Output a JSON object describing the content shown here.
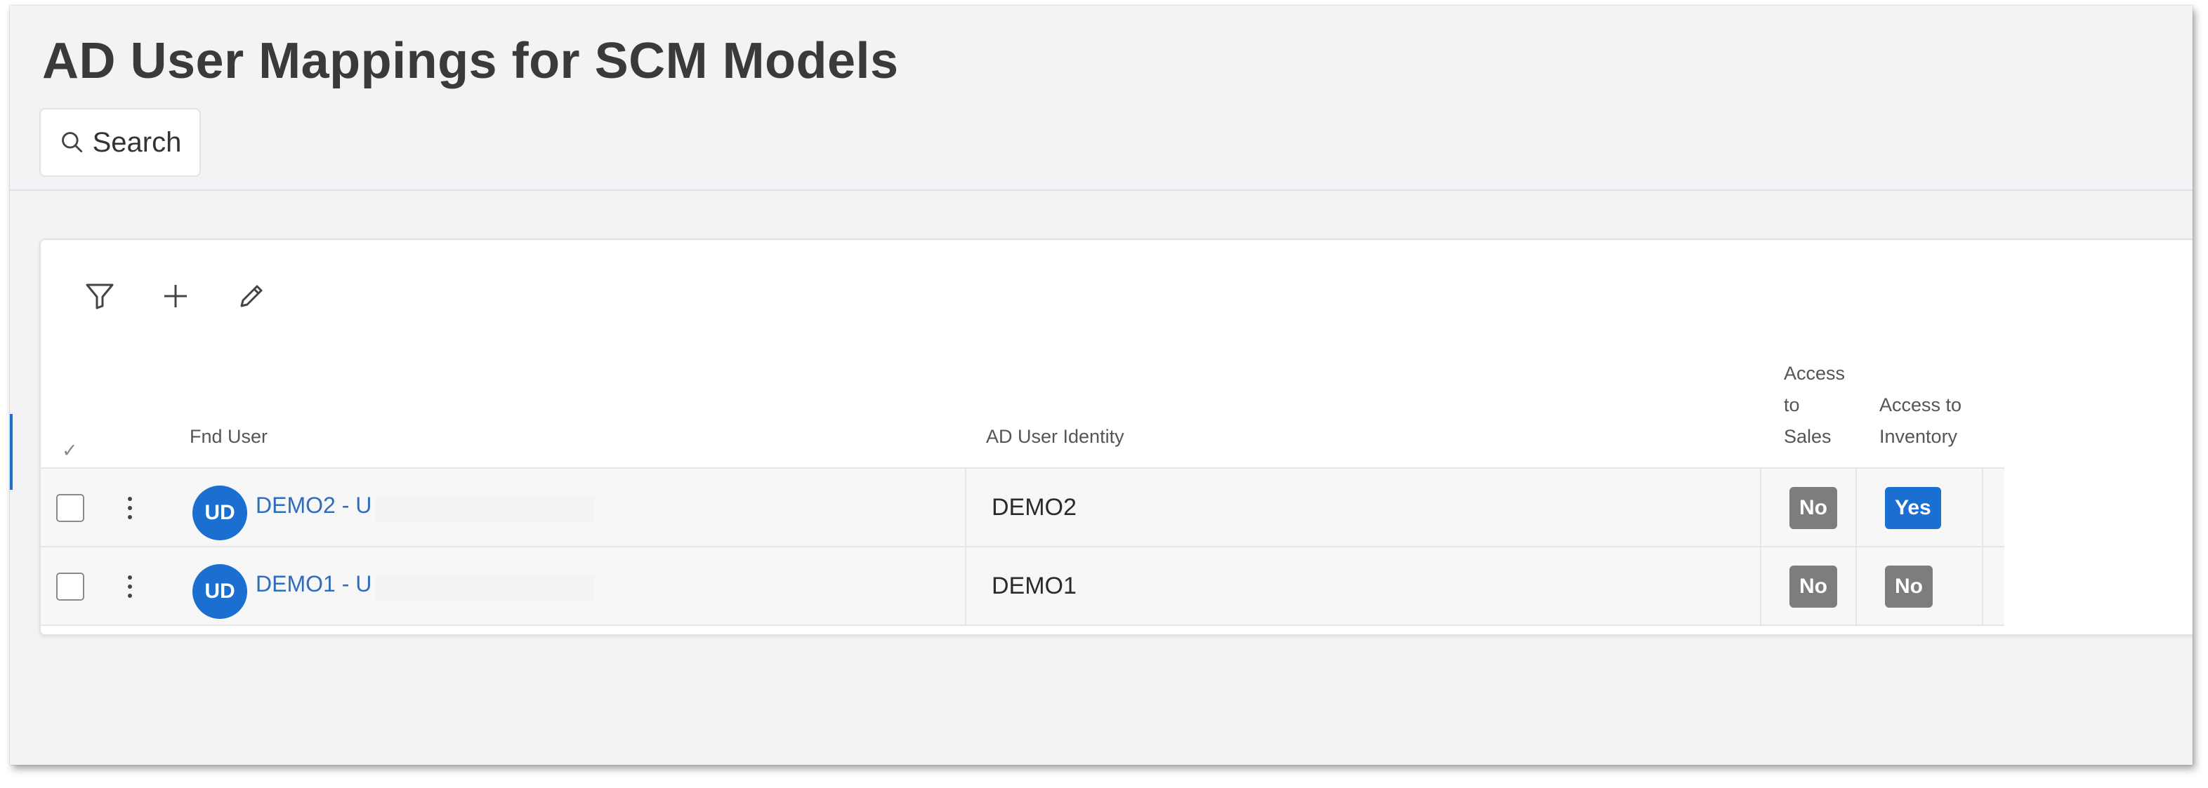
{
  "page": {
    "title": "AD User Mappings for SCM Models"
  },
  "search": {
    "label": "Search"
  },
  "toolbar": {
    "filter_icon": "filter-icon",
    "add_icon": "plus-icon",
    "edit_icon": "pencil-icon"
  },
  "table": {
    "columns": {
      "select": "✓",
      "fnd_user": "Fnd User",
      "ad_identity": "AD User Identity",
      "access_sales": [
        "Access",
        "to",
        "Sales"
      ],
      "access_inventory": [
        "Access to",
        "Inventory"
      ]
    },
    "rows": [
      {
        "avatar": "UD",
        "fnd_user": "DEMO2 - U",
        "ad_identity": "DEMO2",
        "access_sales": "No",
        "access_inventory": "Yes"
      },
      {
        "avatar": "UD",
        "fnd_user": "DEMO1 - U",
        "ad_identity": "DEMO1",
        "access_sales": "No",
        "access_inventory": "No"
      }
    ]
  },
  "colors": {
    "yes_badge": "#1a6fd1",
    "no_badge": "#7d7d7d",
    "avatar": "#1a6fd1",
    "link": "#2f6dbc"
  }
}
